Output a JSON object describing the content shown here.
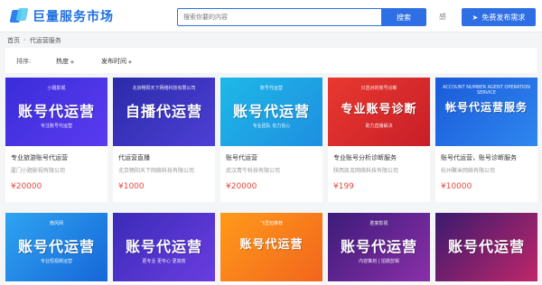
{
  "header": {
    "logo_text": "巨量服务市场",
    "search_placeholder": "搜索你要的内容",
    "search_button": "搜索",
    "lang": "感",
    "publish_button": "免费发布需求"
  },
  "breadcrumb": [
    "首页",
    "代运营服务"
  ],
  "filters": {
    "sort_label": "排序:",
    "option1": "热度",
    "option2": "发布时间"
  },
  "cards": [
    {
      "banner_big": "账号代运营",
      "banner_small": "小题影视",
      "banner_small2": "专注账号代运营",
      "title": "专业旅游账号代运营",
      "company": "厦门小题影视有限公司",
      "price": "¥20000"
    },
    {
      "banner_big": "自播代运营",
      "banner_small": "北京畅阳天下网络科技有限公司",
      "banner_small2": "",
      "title": "代运营直播",
      "company": "北京畅阳天下网络科技有限公司",
      "price": "¥1000"
    },
    {
      "banner_big": "账号代运营",
      "banner_small": "账号代运营",
      "banner_small2": "专业团队 省力省心",
      "title": "账号代运营",
      "company": "武汉青牛科技有限公司",
      "price": "¥20000"
    },
    {
      "banner_big": "专业账号诊断",
      "banner_small": "只选对的账号诊断",
      "banner_small2": "助力直播解决",
      "title": "专业账号分析诊断服务",
      "company": "陕西凯克网络科技有限公司",
      "price": "¥199"
    },
    {
      "banner_big": "帐号代运营服务",
      "banner_small": "ACCOUNT NUMBER AGENT OPERATION SERVICE",
      "banner_small2": "",
      "title": "账号代运营，账号诊断服务",
      "company": "杭州聚米网络有限公司",
      "price": "¥10000"
    },
    {
      "banner_big": "账号代运营",
      "banner_small": "微风网",
      "banner_small2": "专业短视频运营",
      "title": "",
      "company": "",
      "price": ""
    },
    {
      "banner_big": "账号代运营",
      "banner_small": "",
      "banner_small2": "更专业 更专心 更高效",
      "title": "",
      "company": "",
      "price": ""
    },
    {
      "banner_big": "账号代运营",
      "banner_small": "飞里旭推荐",
      "banner_small2": "",
      "title": "",
      "company": "",
      "price": ""
    },
    {
      "banner_big": "账号代运营",
      "banner_small": "胜宴影视",
      "banner_small2": "内容策划 | 拍摄剪辑",
      "title": "",
      "company": "",
      "price": ""
    },
    {
      "banner_big": "账号代运营",
      "banner_small": "",
      "banner_small2": "",
      "title": "",
      "company": "",
      "price": ""
    }
  ],
  "colors": {
    "accent": "#2f6fe4",
    "price": "#e8483c"
  }
}
